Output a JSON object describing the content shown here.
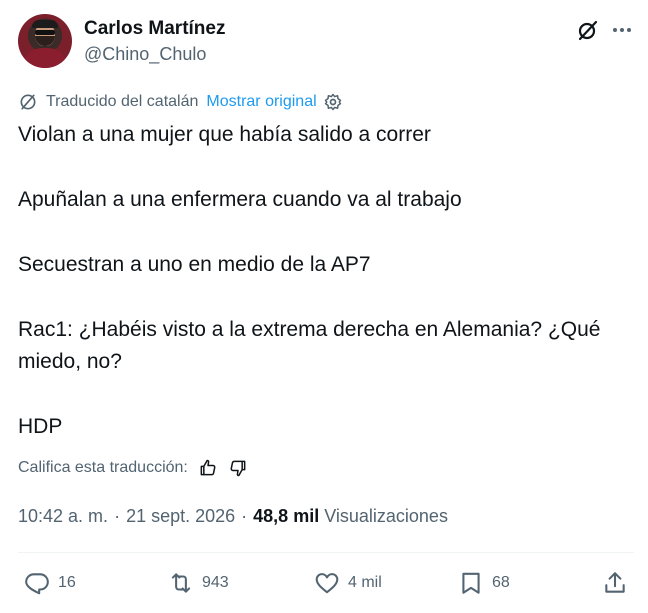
{
  "author": {
    "name": "Carlos Martínez",
    "handle": "@Chino_Chulo"
  },
  "translation": {
    "label": "Traducido del catalán",
    "show_original": "Mostrar original"
  },
  "tweet": {
    "paragraphs": [
      "Violan a una mujer que había salido a correr",
      "Apuñalan a una enfermera cuando va al trabajo",
      "Secuestran a uno en medio de la AP7",
      "Rac1: ¿Habéis visto a la extrema derecha en Alemania? ¿Qué miedo, no?",
      "HDP"
    ]
  },
  "rating": {
    "label": "Califica esta traducción:"
  },
  "meta": {
    "time": "10:42 a. m.",
    "date": "21 sept. 2026",
    "views_count": "48,8 mil",
    "views_label": "Visualizaciones"
  },
  "actions": {
    "replies": "16",
    "reposts": "943",
    "likes": "4 mil",
    "bookmarks": "68"
  },
  "colors": {
    "text": "#0f1419",
    "secondary": "#536471",
    "link": "#1d9bf0"
  },
  "icons": [
    "grok-icon",
    "more-icon",
    "translate-icon",
    "gear-icon",
    "thumbs-up-icon",
    "thumbs-down-icon",
    "reply-icon",
    "repost-icon",
    "like-icon",
    "bookmark-icon",
    "share-icon"
  ]
}
